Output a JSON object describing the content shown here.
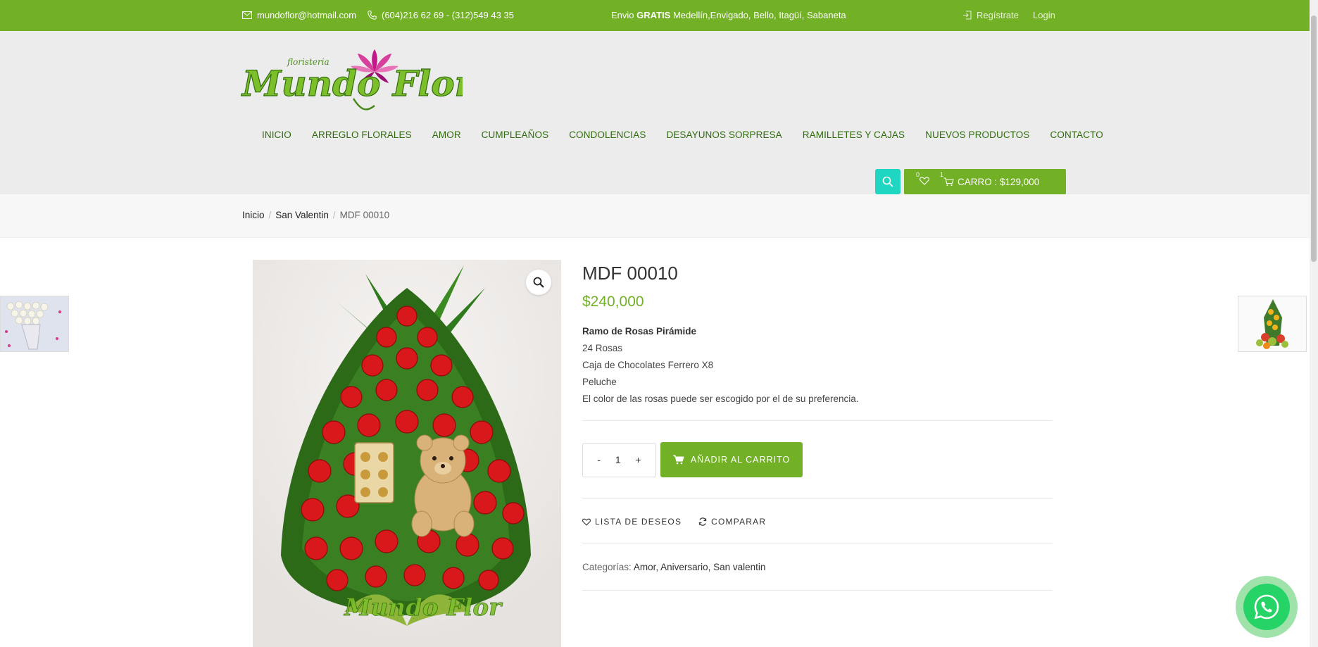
{
  "topbar": {
    "email": "mundoflor@hotmail.com",
    "phone": "(604)216 62 69 - (312)549 43 35",
    "promo_prefix": "Envio",
    "promo_bold": "GRATIS",
    "promo_rest": "Medellín,Envigado, Bello, Itagüí, Sabaneta",
    "register": "Regístrate",
    "login": "Login"
  },
  "brand": {
    "small": "floristeria",
    "name": "Mundo Flor"
  },
  "nav": [
    "INICIO",
    "ARREGLO FLORALES",
    "AMOR",
    "CUMPLEAÑOS",
    "CONDOLENCIAS",
    "DESAYUNOS SORPRESA",
    "RAMILLETES Y CAJAS",
    "NUEVOS PRODUCTOS",
    "CONTACTO"
  ],
  "cart": {
    "wishlist_count": "0",
    "cart_count": "1",
    "label": "CARRO : $129,000"
  },
  "breadcrumb": {
    "home": "Inicio",
    "category": "San Valentin",
    "current": "MDF 00010"
  },
  "product": {
    "title": "MDF 00010",
    "price": "$240,000",
    "description_title": "Ramo de Rosas Pirámide",
    "description_lines": [
      "24 Rosas",
      "Caja de Chocolates Ferrero X8",
      "Peluche",
      "El color de las rosas puede ser escogido por el de su preferencia."
    ],
    "quantity": "1",
    "minus": "-",
    "plus": "+",
    "add_to_cart": "AÑADIR AL CARRITO",
    "wishlist": "LISTA DE DESEOS",
    "compare": "COMPARAR",
    "categories_label": "Categorías:",
    "categories": "Amor, Aniversario, San valentin",
    "watermark": "Mundo Flor"
  },
  "colors": {
    "brand_green": "#72b026",
    "search_teal": "#1fd6c2",
    "nav_green": "#2f6b0c",
    "whatsapp": "#25d366"
  },
  "icons": [
    "envelope-icon",
    "phone-icon",
    "login-icon",
    "search-icon",
    "heart-icon",
    "cart-icon",
    "zoom-icon",
    "refresh-icon",
    "whatsapp-icon"
  ]
}
